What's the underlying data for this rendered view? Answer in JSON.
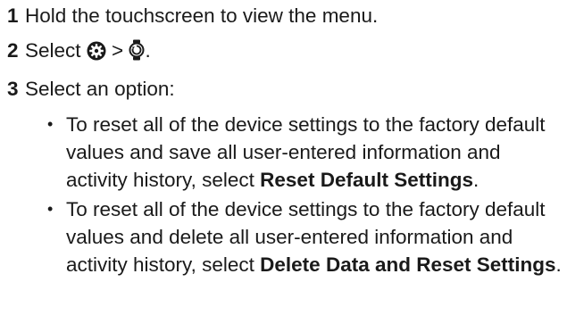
{
  "steps": [
    {
      "num": "1",
      "text": "Hold the touchscreen to view the menu."
    },
    {
      "num": "2",
      "text_before": "Select ",
      "separator": " > ",
      "text_after": ".",
      "icons": [
        "settings-gear-icon",
        "watch-icon"
      ]
    },
    {
      "num": "3",
      "text": "Select an option:"
    }
  ],
  "options": [
    {
      "text": "To reset all of the device settings to the factory default values and save all user-entered information and activity history, select ",
      "bold": "Reset Default Settings",
      "end": "."
    },
    {
      "text": "To reset all of the device settings to the factory default values and delete all user-entered information and activity history, select ",
      "bold": "Delete Data and Reset Settings",
      "end": "."
    }
  ]
}
